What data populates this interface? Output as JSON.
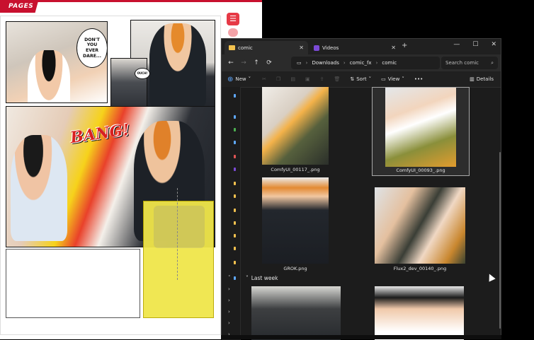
{
  "comic_app": {
    "pages_tab": "PAGES",
    "speech_bubble": "DON'T YOU EVER DARE...",
    "small_bubble": "OUCH!",
    "sfx": "BANG!"
  },
  "explorer": {
    "tabs": [
      {
        "label": "comic",
        "close": "✕"
      },
      {
        "label": "Videos",
        "close": "✕"
      }
    ],
    "new_tab": "+",
    "window_controls": {
      "minimize": "—",
      "maximize": "☐",
      "close": "✕"
    },
    "nav": {
      "back": "←",
      "forward": "→",
      "up": "↑",
      "refresh": "⟳",
      "monitor": "🖵",
      "more": "›"
    },
    "breadcrumb": [
      "Downloads",
      "comic_fx",
      "comic"
    ],
    "search_placeholder": "Search comic",
    "commands": {
      "new": "New",
      "sort": "Sort",
      "view": "View",
      "more": "•••",
      "details": "Details"
    },
    "files": [
      {
        "name": "ComfyUI_00117_.png"
      },
      {
        "name": "ComfyUI_00093_.png"
      },
      {
        "name": "GROK.png"
      },
      {
        "name": "Flux2_dev_00140_.png"
      }
    ],
    "group_last_week": "Last week"
  },
  "colors": {
    "accent_red": "#c8102e",
    "explorer_bg": "#1c1c1c",
    "highlight_yellow": "#f0e64a",
    "folder_yellow": "#f2c14e"
  }
}
